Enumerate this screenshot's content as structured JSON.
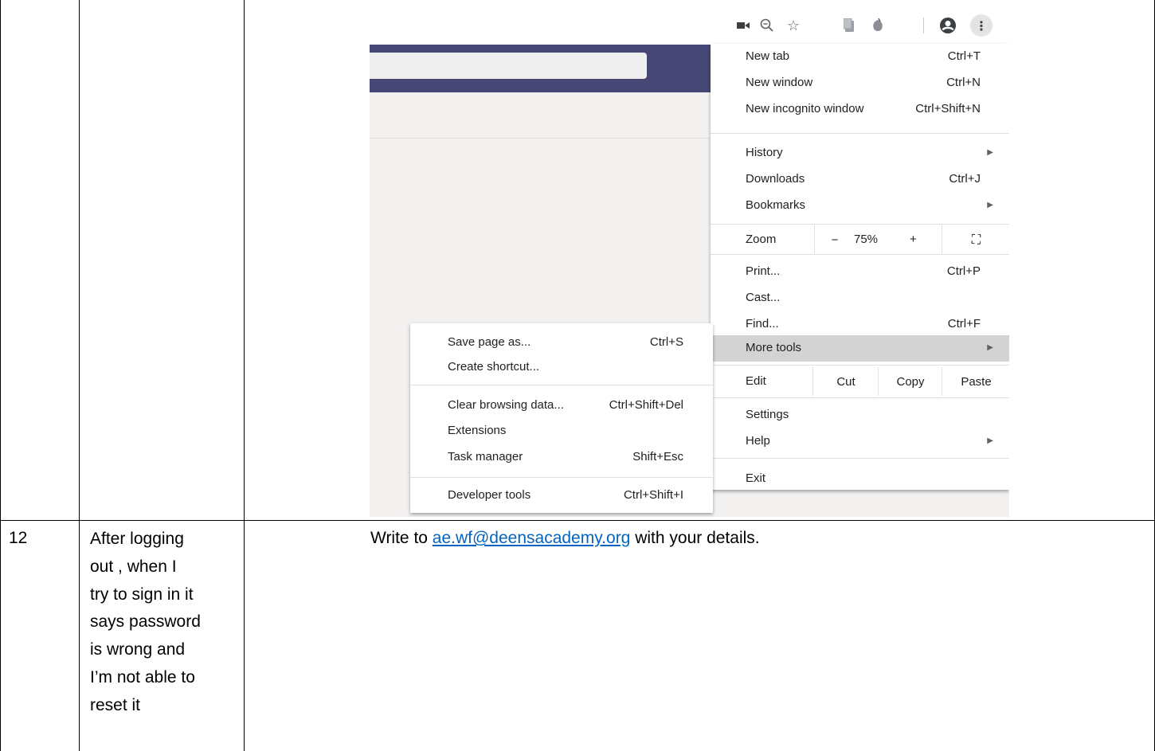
{
  "toolbar": {
    "icons": [
      "video-camera-icon",
      "zoom-out-icon",
      "star-icon",
      "extension-icon",
      "extension-icon-2",
      "profile-icon",
      "menu-icon"
    ]
  },
  "chrome_menu": {
    "new_tab": {
      "label": "New tab",
      "shortcut": "Ctrl+T"
    },
    "new_window": {
      "label": "New window",
      "shortcut": "Ctrl+N"
    },
    "new_incognito": {
      "label": "New incognito window",
      "shortcut": "Ctrl+Shift+N"
    },
    "history": {
      "label": "History"
    },
    "downloads": {
      "label": "Downloads",
      "shortcut": "Ctrl+J"
    },
    "bookmarks": {
      "label": "Bookmarks"
    },
    "zoom": {
      "label": "Zoom",
      "minus": "−",
      "value": "75%",
      "plus": "+"
    },
    "print": {
      "label": "Print...",
      "shortcut": "Ctrl+P"
    },
    "cast": {
      "label": "Cast..."
    },
    "find": {
      "label": "Find...",
      "shortcut": "Ctrl+F"
    },
    "more_tools": {
      "label": "More tools"
    },
    "edit": {
      "label": "Edit",
      "cut": "Cut",
      "copy": "Copy",
      "paste": "Paste"
    },
    "settings": {
      "label": "Settings"
    },
    "help": {
      "label": "Help"
    },
    "exit": {
      "label": "Exit"
    }
  },
  "more_tools_submenu": {
    "save_page": {
      "label": "Save page as...",
      "shortcut": "Ctrl+S"
    },
    "create_shortcut": {
      "label": "Create shortcut..."
    },
    "clear_browsing": {
      "label": "Clear browsing data...",
      "shortcut": "Ctrl+Shift+Del"
    },
    "extensions": {
      "label": "Extensions"
    },
    "task_manager": {
      "label": "Task manager",
      "shortcut": "Shift+Esc"
    },
    "developer_tools": {
      "label": "Developer tools",
      "shortcut": "Ctrl+Shift+I"
    }
  },
  "row12": {
    "number": "12",
    "question_lines": [
      "After logging",
      "out , when I",
      "try to sign in it",
      "says password",
      "is wrong and",
      "I’m not able to",
      "reset it"
    ],
    "answer_prefix": "Write to ",
    "answer_email": "ae.wf@deensacademy.org",
    "answer_suffix": " with your details."
  },
  "colors": {
    "teams_band": "#464775",
    "highlight": "#d3d3d3",
    "link": "#0563c1"
  }
}
